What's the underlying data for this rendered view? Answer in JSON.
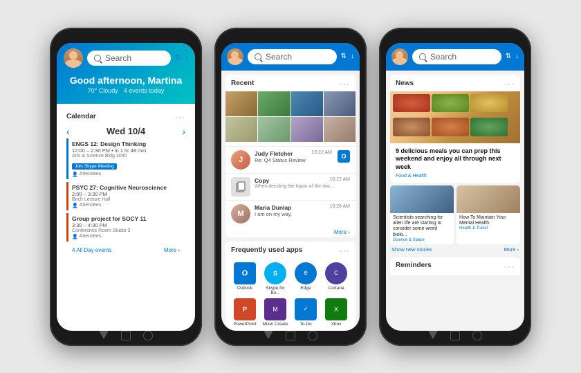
{
  "phones": [
    {
      "id": "phone1",
      "topbar": {
        "search_placeholder": "Search",
        "has_avatar": true
      },
      "header": {
        "greeting": "Good afternoon, Martina",
        "weather": "70° Cloudy",
        "events": "4 events today"
      },
      "calendar": {
        "title": "Calendar",
        "date": "Wed 10/4",
        "events": [
          {
            "title": "ENGS 12: Design Thinking",
            "time": "12:00 – 2:30 PM • in 1 hr 48 min",
            "location": "Arts & Science Bldg 3040",
            "attendees": "Attendees",
            "join_label": "Join Skype Meeting"
          },
          {
            "title": "PSYC 27: Cognitive Neuroscience",
            "time": "2:00 – 3:30 PM",
            "location": "Birch Lecture Hall",
            "attendees": "Attendees"
          },
          {
            "title": "Group project for SOCY 11",
            "time": "3:30 – 4:30 PM",
            "location": "Conference Room Studio 3",
            "attendees": "Attendees"
          }
        ],
        "all_day": "4 All Day events",
        "more": "More ›"
      }
    },
    {
      "id": "phone2",
      "topbar": {
        "search_placeholder": "Search",
        "has_avatar": true
      },
      "recent": {
        "title": "Recent",
        "photos": 8,
        "emails": [
          {
            "sender": "Judy Fletcher",
            "subject": "Re: Q4 Status Review",
            "time": "10:22 AM",
            "icon": "outlook"
          },
          {
            "sender": "Copy",
            "subject": "When deciding the layou of the doc...",
            "time": "10:22 AM",
            "icon": "copy"
          },
          {
            "sender": "Maria Dunlap",
            "subject": "I am on my way.",
            "time": "10:28 AM",
            "icon": "person"
          }
        ],
        "more": "More ›"
      },
      "apps": {
        "title": "Frequently used apps",
        "items": [
          {
            "label": "Outlook",
            "icon": "O"
          },
          {
            "label": "Skype for Bu...",
            "icon": "S"
          },
          {
            "label": "Edge",
            "icon": "e"
          },
          {
            "label": "Cortana",
            "icon": "C"
          },
          {
            "label": "PowerPoint",
            "icon": "P"
          },
          {
            "label": "Mixer Create",
            "icon": "M"
          },
          {
            "label": "To-Do",
            "icon": "✓"
          },
          {
            "label": "Xbox",
            "icon": "X"
          }
        ]
      }
    },
    {
      "id": "phone3",
      "topbar": {
        "search_placeholder": "Search",
        "has_avatar": true
      },
      "news": {
        "title": "News",
        "main_article": {
          "title": "9 delicious meals you can prep this weekend and enjoy all through next week",
          "category": "Food & Health"
        },
        "small_articles": [
          {
            "title": "Scientists searching for alien life are starting to consider some weird biolo...",
            "category": "Science & Space"
          },
          {
            "title": "How To Maintain Your Mental Health",
            "category": "Health & Travel"
          }
        ],
        "show_more": "Show new stories",
        "more": "More ›"
      },
      "reminders": {
        "title": "Reminders"
      }
    }
  ]
}
